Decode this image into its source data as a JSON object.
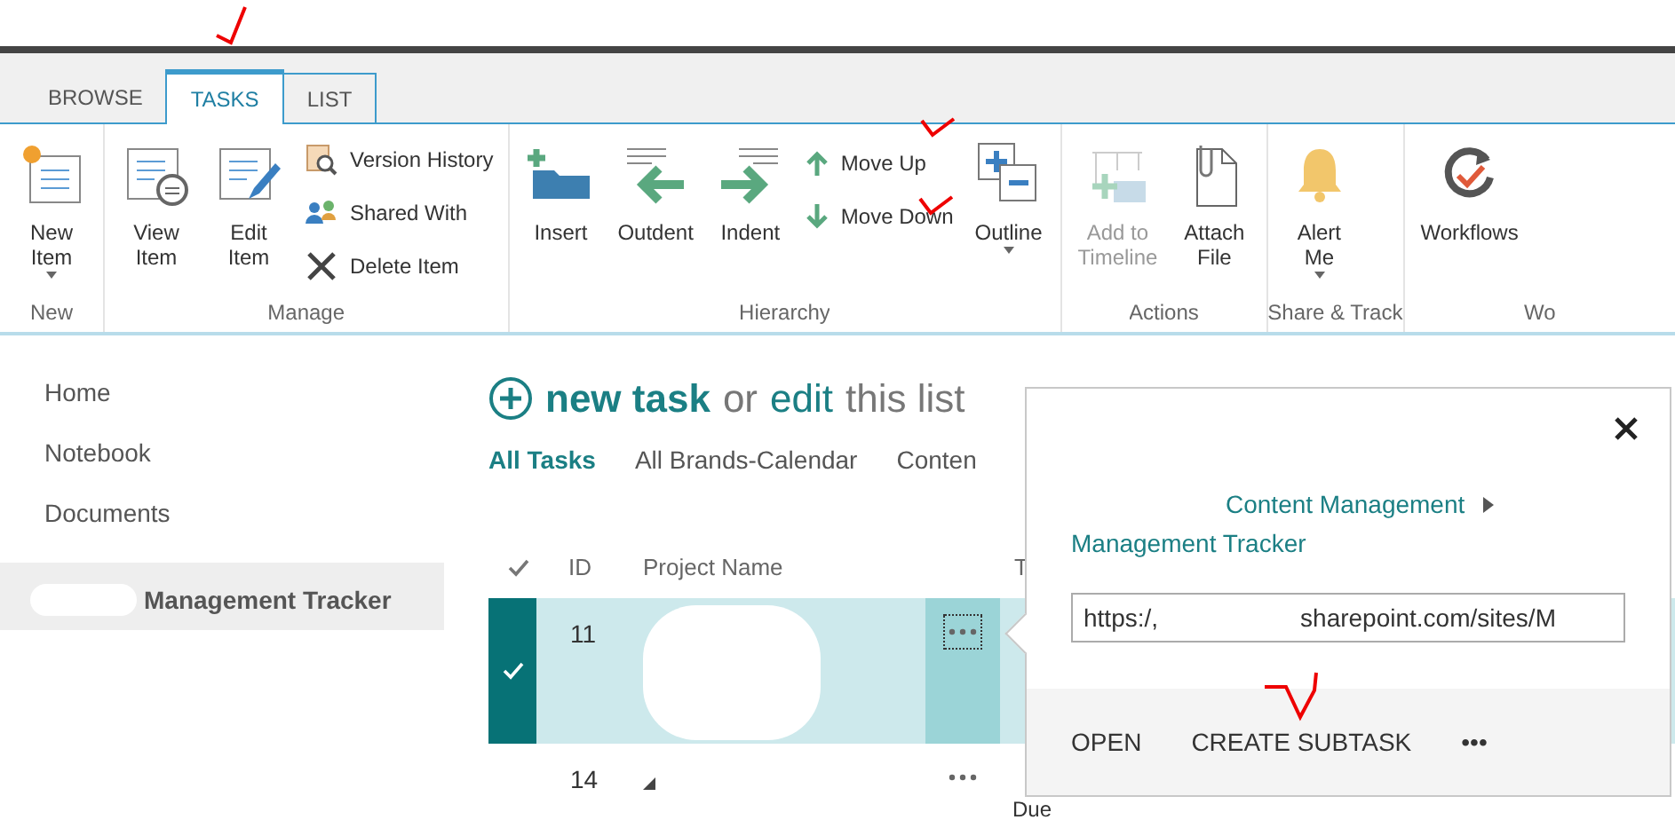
{
  "tabs": [
    {
      "label": "BROWSE",
      "selected": false
    },
    {
      "label": "TASKS",
      "selected": true
    },
    {
      "label": "LIST",
      "selected": false
    }
  ],
  "ribbon": {
    "groups": [
      {
        "label": "New",
        "commands": [
          {
            "kind": "large",
            "label": "New\nItem",
            "dropdown": true,
            "disabled": false
          }
        ]
      },
      {
        "label": "Manage",
        "commands": [
          {
            "kind": "large",
            "label": "View\nItem",
            "dropdown": false,
            "disabled": false
          },
          {
            "kind": "large",
            "label": "Edit\nItem",
            "dropdown": false,
            "disabled": false
          },
          {
            "kind": "small",
            "label": "Version History",
            "dropdown": false,
            "disabled": false
          },
          {
            "kind": "small",
            "label": "Shared With",
            "dropdown": false,
            "disabled": false
          },
          {
            "kind": "small",
            "label": "Delete Item",
            "dropdown": false,
            "disabled": false
          }
        ]
      },
      {
        "label": "Hierarchy",
        "commands": [
          {
            "kind": "large",
            "label": "Insert",
            "dropdown": false,
            "disabled": false
          },
          {
            "kind": "large",
            "label": "Outdent",
            "dropdown": false,
            "disabled": false
          },
          {
            "kind": "large",
            "label": "Indent",
            "dropdown": false,
            "disabled": false
          },
          {
            "kind": "small",
            "label": "Move Up",
            "dropdown": false,
            "disabled": false
          },
          {
            "kind": "small",
            "label": "Move Down",
            "dropdown": false,
            "disabled": false
          },
          {
            "kind": "large",
            "label": "Outline",
            "dropdown": true,
            "disabled": false
          }
        ]
      },
      {
        "label": "Actions",
        "commands": [
          {
            "kind": "large",
            "label": "Add to\nTimeline",
            "dropdown": false,
            "disabled": true
          },
          {
            "kind": "large",
            "label": "Attach\nFile",
            "dropdown": false,
            "disabled": false
          }
        ]
      },
      {
        "label": "Share & Track",
        "commands": [
          {
            "kind": "large",
            "label": "Alert\nMe",
            "dropdown": true,
            "disabled": false
          }
        ]
      },
      {
        "label": "Wo",
        "commands": [
          {
            "kind": "large",
            "label": "Workflows",
            "dropdown": false,
            "disabled": false
          }
        ]
      }
    ]
  },
  "sidebar": {
    "items": [
      {
        "label": "Home",
        "selected": false,
        "redacted": false
      },
      {
        "label": "Notebook",
        "selected": false,
        "redacted": false
      },
      {
        "label": "Documents",
        "selected": false,
        "redacted": false
      },
      {
        "label": "Management Tracker",
        "selected": true,
        "redacted": true
      }
    ]
  },
  "heading": [
    {
      "text": "new task",
      "kind": "link"
    },
    {
      "text": "or",
      "kind": "plain"
    },
    {
      "text": "edit",
      "kind": "link"
    },
    {
      "text": "this list",
      "kind": "plain"
    }
  ],
  "views": [
    {
      "label": "All Tasks",
      "selected": true
    },
    {
      "label": "All Brands-Calendar",
      "selected": false
    },
    {
      "label": "Conten",
      "selected": false
    }
  ],
  "table": {
    "columns": [
      "ID",
      "Project Name",
      "T"
    ],
    "rows": [
      {
        "id": "11",
        "selected": true,
        "redacted": true,
        "expandable": false
      },
      {
        "id": "14",
        "selected": false,
        "redacted": false,
        "expandable": true,
        "column_3": "Due"
      }
    ]
  },
  "callout": {
    "breadcrumb": "Content Management",
    "title": "Management Tracker",
    "url": [
      "https:/,",
      "sharepoint.com/sites/M"
    ],
    "actions": [
      "OPEN",
      "CREATE SUBTASK",
      "•••"
    ]
  }
}
